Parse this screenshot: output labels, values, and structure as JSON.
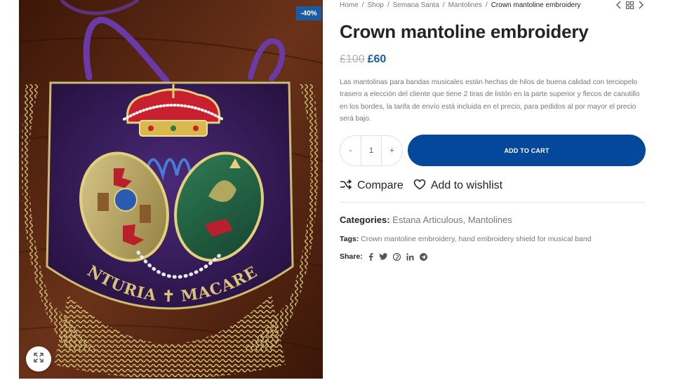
{
  "sale_badge": "-40%",
  "breadcrumb": {
    "items": [
      "Home",
      "Shop",
      "Semana Santa",
      "Mantolines"
    ],
    "current": "Crown mantoline embroidery",
    "separator": "/"
  },
  "product": {
    "title": "Crown mantoline embroidery",
    "old_price": "£100",
    "new_price": "£60",
    "description": "Las mantolinas para bandas musicales están hechas de hilos de buena calidad con terciopelo trasero a elección del cliente que tiene 2 tiras de listón en la parte superior y flecos de canutillo en los bordes, la tarifa de envío está incluida en el precio, para pedidos al por mayor el precio será bajo."
  },
  "quantity": {
    "minus": "-",
    "value": "1",
    "plus": "+"
  },
  "add_to_cart_label": "ADD TO CART",
  "actions": {
    "compare": "Compare",
    "wishlist": "Add to wishlist"
  },
  "categories": {
    "label": "Categories:",
    "items": [
      "Estana Articulous",
      "Mantolines"
    ]
  },
  "tags": {
    "label": "Tags:",
    "items": [
      "Crown mantoline embroidery",
      "hand embroidery shield for musical band"
    ]
  },
  "share": {
    "label": "Share:",
    "icons": [
      "facebook-icon",
      "twitter-icon",
      "pinterest-icon",
      "linkedin-icon",
      "telegram-icon"
    ]
  },
  "image": {
    "embroidered_text": "CENTURIA ✝ MACARENA"
  },
  "colors": {
    "accent": "#05489b",
    "price": "#1a5ba6",
    "badge": "#1a5ba6",
    "velvet": "#3d1f63",
    "gold": "#cdbb73",
    "wood": "#5a2a14"
  }
}
